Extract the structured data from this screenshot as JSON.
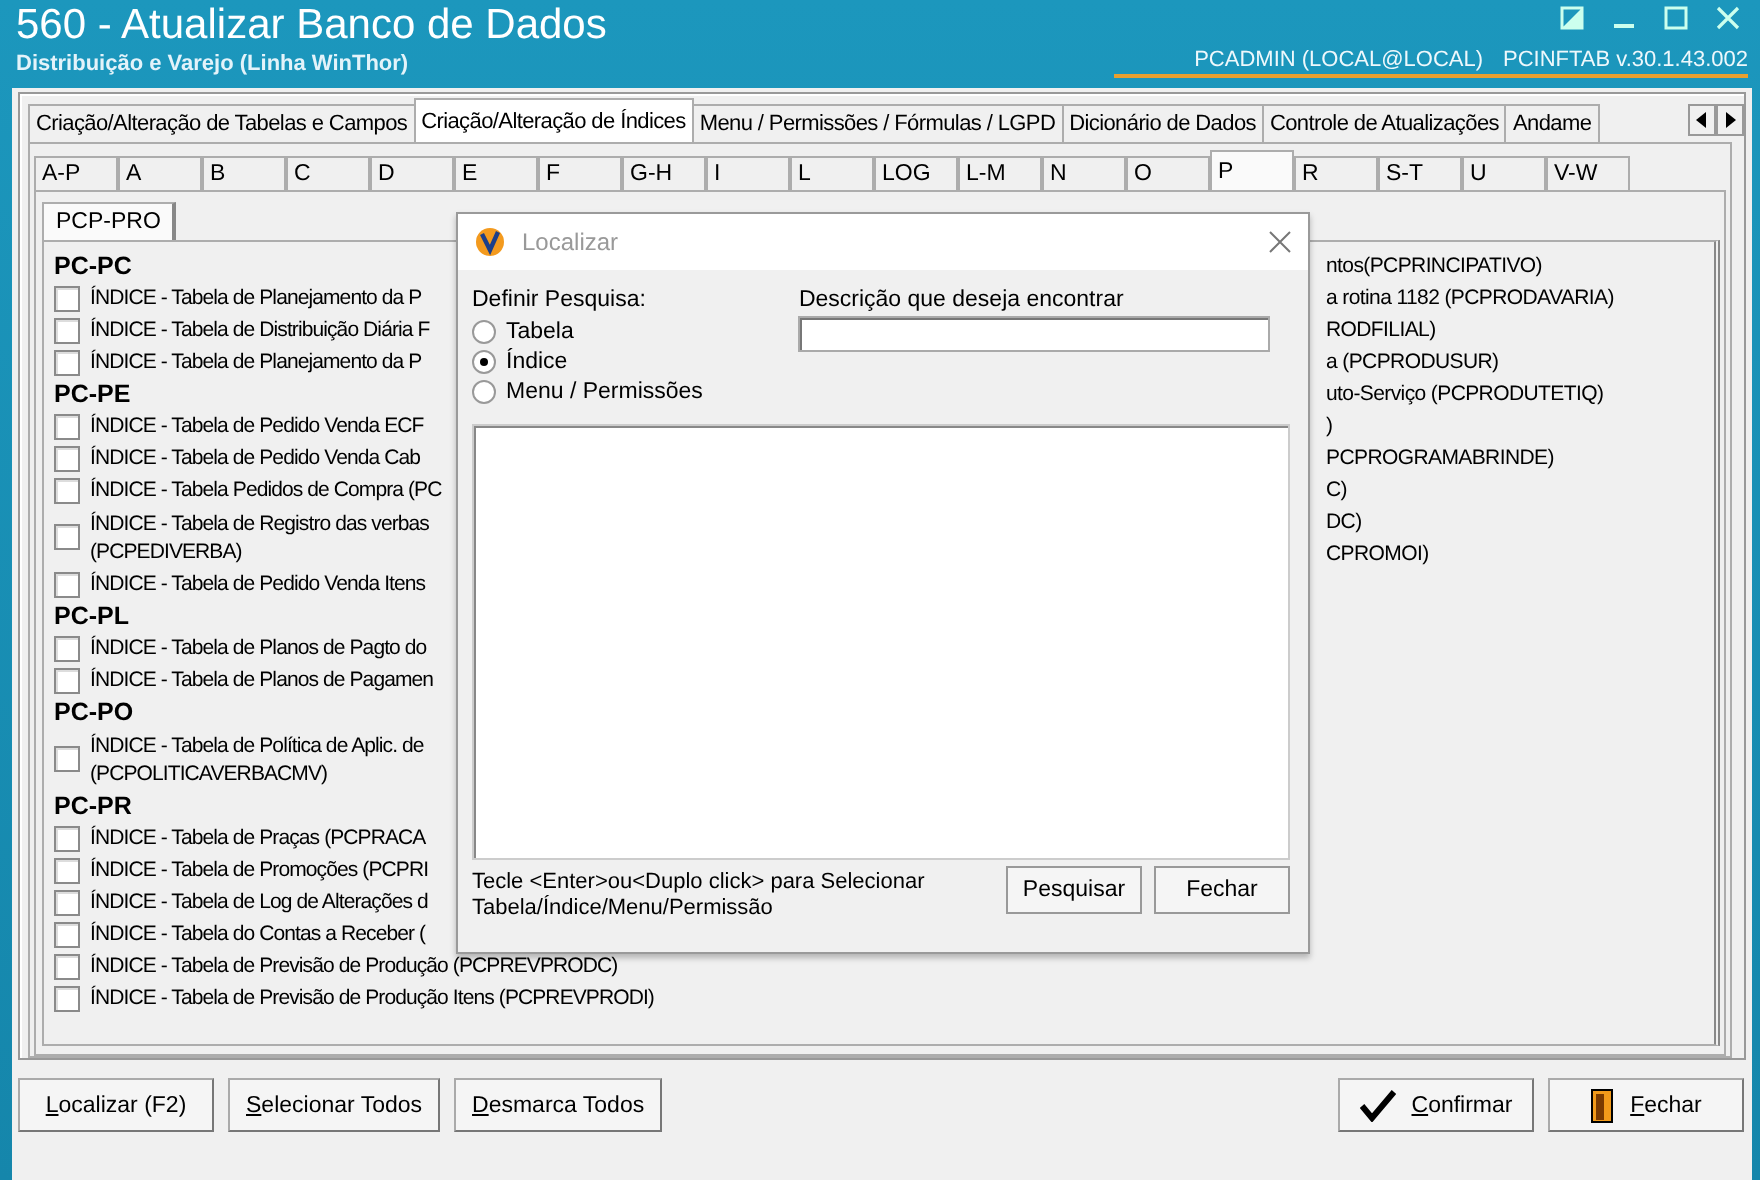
{
  "window": {
    "title": "560 - Atualizar Banco de Dados",
    "subtitle": "Distribuição e Varejo (Linha WinThor)",
    "user": "PCADMIN (LOCAL@LOCAL)",
    "version": "PCINFTAB  v.30.1.43.002"
  },
  "main_tabs": [
    {
      "label": "Criação/Alteração de Tabelas e Campos",
      "selected": false
    },
    {
      "label": "Criação/Alteração de Índices",
      "selected": true
    },
    {
      "label": "Menu / Permissões / Fórmulas / LGPD",
      "selected": false
    },
    {
      "label": "Dicionário de Dados",
      "selected": false
    },
    {
      "label": "Controle de Atualizações",
      "selected": false
    },
    {
      "label": "Andame",
      "selected": false
    }
  ],
  "letter_tabs": [
    {
      "label": "A-P",
      "selected": false
    },
    {
      "label": "A",
      "selected": false
    },
    {
      "label": "B",
      "selected": false
    },
    {
      "label": "C",
      "selected": false
    },
    {
      "label": "D",
      "selected": false
    },
    {
      "label": "E",
      "selected": false
    },
    {
      "label": "F",
      "selected": false
    },
    {
      "label": "G-H",
      "selected": false
    },
    {
      "label": "I",
      "selected": false
    },
    {
      "label": "L",
      "selected": false
    },
    {
      "label": "LOG",
      "selected": false
    },
    {
      "label": "L-M",
      "selected": false
    },
    {
      "label": "N",
      "selected": false
    },
    {
      "label": "O",
      "selected": false
    },
    {
      "label": "P",
      "selected": true
    },
    {
      "label": "R",
      "selected": false
    },
    {
      "label": "S-T",
      "selected": false
    },
    {
      "label": "U",
      "selected": false
    },
    {
      "label": "V-W",
      "selected": false
    }
  ],
  "sub_tabs": [
    {
      "label": "PCP-PRO",
      "selected": true
    }
  ],
  "groups": [
    {
      "header": "PC-PC",
      "items": [
        {
          "label": "ÍNDICE - Tabela  de Planejamento da P",
          "checked": false
        },
        {
          "label": "ÍNDICE - Tabela de Distribuição Diária F",
          "checked": false
        },
        {
          "label": "ÍNDICE - Tabela  de Planejamento da P",
          "checked": false
        }
      ]
    },
    {
      "header": "PC-PE",
      "items": [
        {
          "label": "ÍNDICE - Tabela de Pedido Venda ECF",
          "checked": false
        },
        {
          "label": "ÍNDICE - Tabela  de Pedido Venda Cab",
          "checked": false
        },
        {
          "label": "ÍNDICE - Tabela Pedidos de Compra (PC",
          "checked": false
        },
        {
          "label": "ÍNDICE - Tabela de Registro das verbas",
          "label2": "(PCPEDIVERBA)",
          "checked": false
        },
        {
          "label": "ÍNDICE - Tabela  de Pedido Venda Itens",
          "checked": false
        }
      ]
    },
    {
      "header": "PC-PL",
      "items": [
        {
          "label": "ÍNDICE - Tabela de Planos de Pagto do",
          "checked": false
        },
        {
          "label": "ÍNDICE - Tabela de Planos de Pagamen",
          "checked": false
        }
      ]
    },
    {
      "header": "PC-PO",
      "items": [
        {
          "label": "ÍNDICE - Tabela de Política de Aplic. de",
          "label2": "(PCPOLITICAVERBACMV)",
          "checked": false
        }
      ]
    },
    {
      "header": "PC-PR",
      "items": [
        {
          "label": "ÍNDICE - Tabela  de Praças (PCPRACA",
          "checked": false
        },
        {
          "label": "ÍNDICE - Tabela de Promoções  (PCPRI",
          "checked": false
        },
        {
          "label": "ÍNDICE - Tabela de Log de Alterações d",
          "checked": false
        },
        {
          "label": "ÍNDICE - Tabela do Contas a Receber (",
          "checked": false
        },
        {
          "label": "ÍNDICE - Tabela  de Previsão de Produção (PCPREVPRODC)",
          "checked": false
        },
        {
          "label": "ÍNDICE - Tabela  de Previsão de Produção Itens (PCPREVPRODI)",
          "checked": false
        }
      ]
    }
  ],
  "right_column": [
    "ntos(PCPRINCIPATIVO)",
    "a rotina 1182 (PCPRODAVARIA)",
    "RODFILIAL)",
    "a (PCPRODUSUR)",
    "uto-Serviço (PCPRODUTETIQ)",
    ")",
    "PCPROGRAMABRINDE)",
    "C)",
    "DC)",
    "CPROMOI)"
  ],
  "dialog": {
    "title": "Localizar",
    "search_label": "Definir Pesquisa:",
    "options": [
      {
        "label": "Tabela",
        "selected": false
      },
      {
        "label": "Índice",
        "selected": true
      },
      {
        "label": "Menu / Permissões",
        "selected": false
      }
    ],
    "description_label": "Descrição que deseja encontrar",
    "hint_lines": [
      "Tecle <Enter>ou<Duplo click> para Selecionar",
      "Tabela/Índice/Menu/Permissão"
    ],
    "buttons": [
      "Pesquisar",
      "Fechar"
    ]
  },
  "buttons_left": [
    "Localizar (F2)",
    "Selecionar Todos",
    "Desmarca Todos"
  ],
  "buttons_right": [
    {
      "label": "Confirmar",
      "kind": "confirm"
    },
    {
      "label": "Fechar",
      "kind": "exit"
    }
  ]
}
